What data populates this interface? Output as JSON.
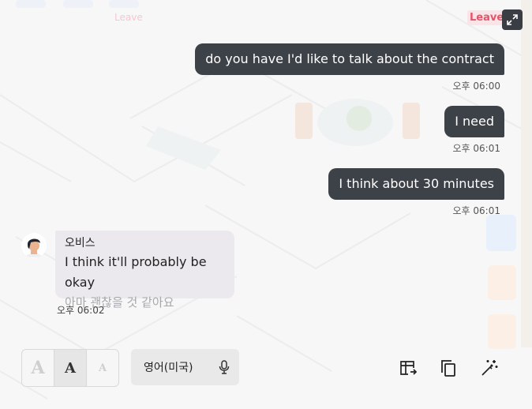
{
  "header": {
    "ghost_leave": "Leave",
    "leave_label": "Leave"
  },
  "messages_out": [
    {
      "text": "do you have I'd like to talk about the contract",
      "time": "오후 06:00"
    },
    {
      "text": "I need",
      "time": "오후 06:01"
    },
    {
      "text": "I think about 30 minutes",
      "time": "오후 06:01"
    }
  ],
  "message_in": {
    "sender": "오비스",
    "text": "I think it'll probably be okay",
    "translation": "아마 괜찮을 것 같아요",
    "time": "오후 06:02"
  },
  "toolbar": {
    "font_sizes": [
      "A",
      "A",
      "A"
    ],
    "language": "영어(미국)",
    "icons": [
      "expand-icon",
      "microphone-icon",
      "table-export-icon",
      "copy-icon",
      "magic-wand-icon"
    ]
  },
  "colors": {
    "bubble_out": "#3d4148",
    "bubble_in": "#ebe9ee",
    "leave": "#e0566a"
  }
}
